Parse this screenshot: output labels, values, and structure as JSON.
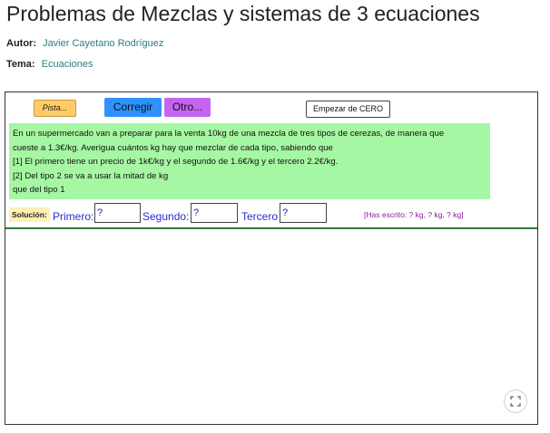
{
  "page": {
    "title": "Problemas de Mezclas y sistemas de 3 ecuaciones",
    "autor_label": "Autor:",
    "autor_value": "Javier Cayetano Rodríguez",
    "tema_label": "Tema:",
    "tema_value": "Ecuaciones"
  },
  "applet": {
    "buttons": {
      "pista": "Pista...",
      "corregir": "Corregir",
      "otro": "Otro...",
      "reset": "Empezar de CERO"
    },
    "problem_lines": [
      " En un supermercado van a preparar para la venta 10kg de una mezcla de tres tipos de cerezas, de manera que",
      " cueste a 1.3€/kg. Averigua cuántos kg hay que mezclar de cada tipo, sabiendo que",
      "[1] El primero tiene un precio de 1k€/kg y el segundo de 1.6€/kg y el tercero 2.2€/kg.",
      "[2] Del tipo 2 se va a usar la mitad de kg",
      "  que del tipo 1"
    ],
    "solution": {
      "label": "Solución:",
      "primero_label": "Primero:",
      "primero_value": "?",
      "segundo_label": "Segundo:",
      "segundo_value": "?",
      "tercero_label": "Tercero",
      "tercero_value": "?",
      "written_echo": "[Has escrito: ? kg, ? kg, ? kg]"
    },
    "icons": {
      "fullscreen": "fullscreen-icon"
    }
  }
}
